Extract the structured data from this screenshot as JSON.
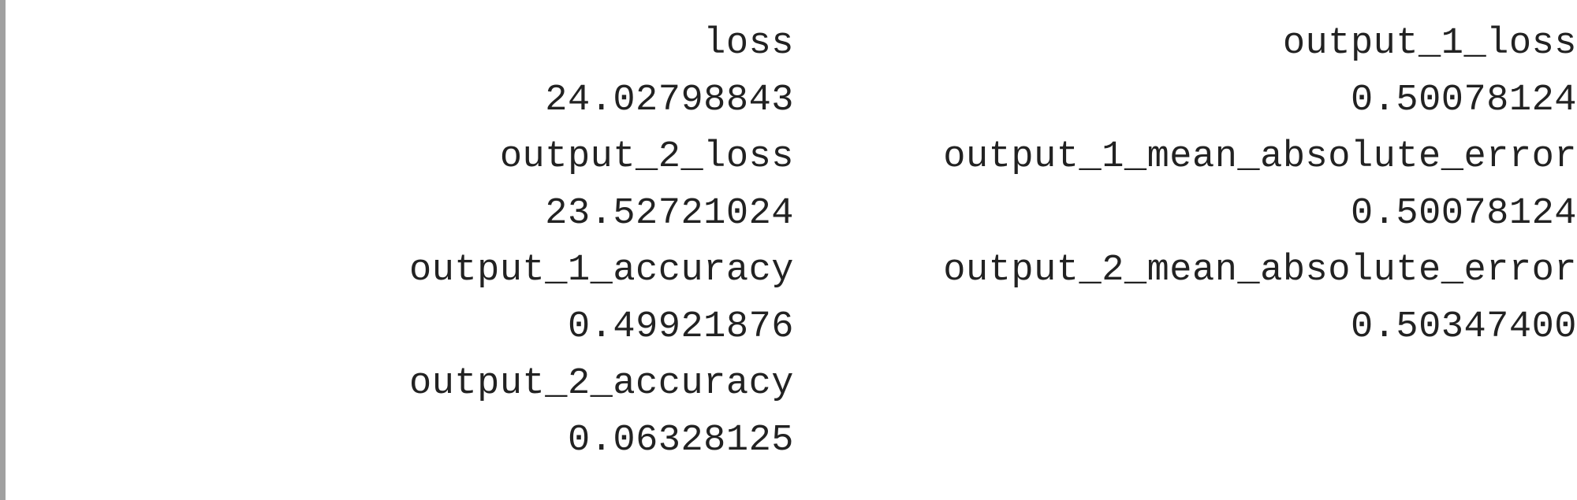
{
  "metrics": {
    "col1": [
      {
        "name": "loss",
        "value": "24.02798843"
      },
      {
        "name": "output_2_loss",
        "value": "23.52721024"
      },
      {
        "name": "output_1_accuracy",
        "value": "0.49921876"
      },
      {
        "name": "output_2_accuracy",
        "value": "0.06328125"
      }
    ],
    "col2": [
      {
        "name": "output_1_loss",
        "value": "0.50078124"
      },
      {
        "name": "output_1_mean_absolute_error",
        "value": "0.50078124"
      },
      {
        "name": "output_2_mean_absolute_error",
        "value": "0.50347400"
      }
    ]
  },
  "colors": {
    "text": "#222222",
    "rule": "#a0a0a0",
    "background": "#ffffff"
  }
}
